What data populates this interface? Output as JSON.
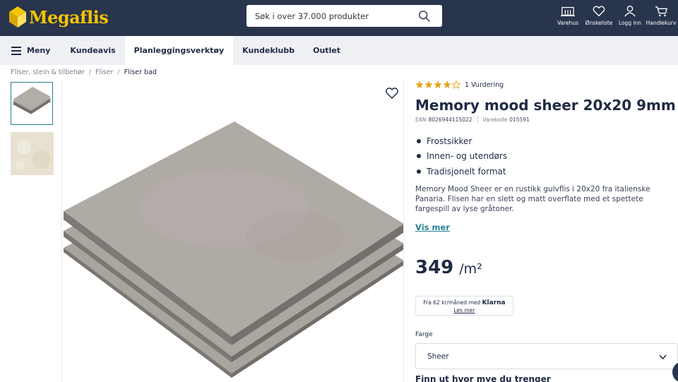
{
  "header": {
    "logo_text": "Megaflis",
    "search_placeholder": "Søk i over 37.000 produkter",
    "actions": [
      {
        "label": "Varehus",
        "icon": "store-icon"
      },
      {
        "label": "Ønskeliste",
        "icon": "heart-icon"
      },
      {
        "label": "Logg inn",
        "icon": "user-icon"
      },
      {
        "label": "Handlekurv",
        "icon": "cart-icon"
      }
    ]
  },
  "nav": {
    "items": [
      {
        "label": "Meny"
      },
      {
        "label": "Kundeavis"
      },
      {
        "label": "Planleggingsverktøy",
        "active": true
      },
      {
        "label": "Kundeklubb"
      },
      {
        "label": "Outlet"
      }
    ]
  },
  "breadcrumb": [
    "Fliser, stein & tilbehør",
    "Fliser",
    "Fliser bad"
  ],
  "product": {
    "rating_value": 4,
    "rating_max": 5,
    "rating_label": "1 Vurdering",
    "title": "Memory mood sheer 20x20 9mm",
    "ean_label": "EAN",
    "ean": "8026944115022",
    "sku_label": "Varekode",
    "sku": "015591",
    "bullets": [
      "Frostsikker",
      "Innen- og utendørs",
      "Tradisjonelt format"
    ],
    "description": "Memory Mood Sheer er en rustikk gulvflis i 20x20 fra italienske Panaria. Flisen har en slett og matt overflate med et spettete fargespill av lyse gråtoner.",
    "more_link": "Vis mer",
    "price": "349",
    "price_unit": "/m²",
    "klarna_text": "Fra 62 kr/måned med",
    "klarna_brand": "Klarna",
    "klarna_link": "Les mer",
    "color_label": "Farge",
    "color_value": "Sheer",
    "calc_heading": "Finn ut hvor mye du trenger"
  },
  "colors": {
    "header_bg": "#29344d",
    "accent": "#2a7f94",
    "logo": "#f5c400",
    "star": "#e8a317",
    "tile": "#a9a39f"
  }
}
